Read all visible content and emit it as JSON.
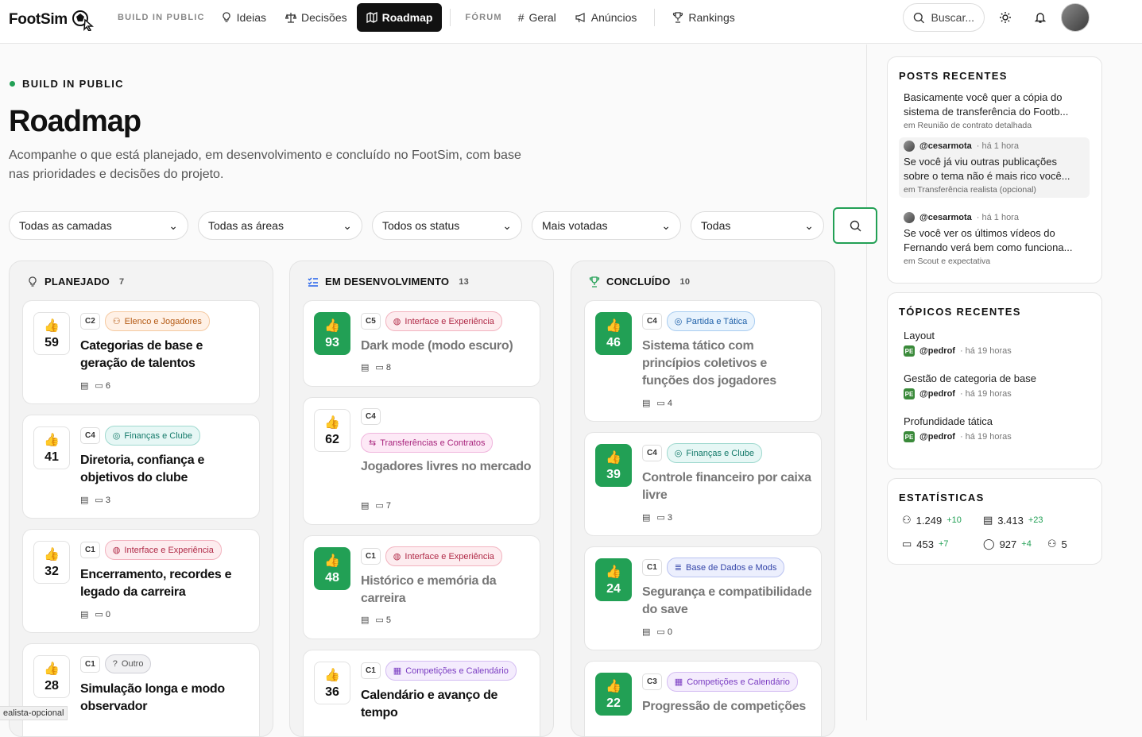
{
  "brand": "FootSim",
  "nav": {
    "section_build": "BUILD IN PUBLIC",
    "ideias": "Ideias",
    "decisoes": "Decisões",
    "roadmap": "Roadmap",
    "section_forum": "FÓRUM",
    "geral": "Geral",
    "anuncios": "Anúncios",
    "rankings": "Rankings",
    "search": "Buscar..."
  },
  "header": {
    "kicker": "BUILD IN PUBLIC",
    "title": "Roadmap",
    "subtitle": "Acompanhe o que está planejado, em desenvolvimento e concluído no FootSim, com base nas prioridades e decisões do projeto."
  },
  "filters": {
    "camadas": "Todas as camadas",
    "areas": "Todas as áreas",
    "status": "Todos os status",
    "ordem": "Mais votadas",
    "todas": "Todas"
  },
  "columns": [
    {
      "title": "PLANEJADO",
      "count": "7",
      "cards": [
        {
          "votes": "59",
          "layer": "C2",
          "area": "Elenco e Jogadores",
          "title": "Categorias de base e geração de talentos",
          "docs": "",
          "comments": "6"
        },
        {
          "votes": "41",
          "layer": "C4",
          "area": "Finanças e Clube",
          "title": "Diretoria, confiança e objetivos do clube",
          "docs": "",
          "comments": "3"
        },
        {
          "votes": "32",
          "layer": "C1",
          "area": "Interface e Experiência",
          "title": "Encerramento, recordes e legado da carreira",
          "docs": "",
          "comments": "0"
        },
        {
          "votes": "28",
          "layer": "C1",
          "area": "Outro",
          "title": "Simulação longa e modo observador",
          "docs": "",
          "comments": ""
        }
      ]
    },
    {
      "title": "EM DESENVOLVIMENTO",
      "count": "13",
      "cards": [
        {
          "votes": "93",
          "layer": "C5",
          "area": "Interface e Experiência",
          "title": "Dark mode (modo escuro)",
          "docs": "",
          "comments": "8"
        },
        {
          "votes": "62",
          "layer": "C4",
          "area": "Transferências e Contratos",
          "title": "Jogadores livres no mercado",
          "docs": "",
          "comments": "7"
        },
        {
          "votes": "48",
          "layer": "C1",
          "area": "Interface e Experiência",
          "title": "Histórico e memória da carreira",
          "docs": "",
          "comments": "5"
        },
        {
          "votes": "36",
          "layer": "C1",
          "area": "Competições e Calendário",
          "title": "Calendário e avanço de tempo",
          "docs": "",
          "comments": ""
        }
      ]
    },
    {
      "title": "CONCLUÍDO",
      "count": "10",
      "cards": [
        {
          "votes": "46",
          "layer": "C4",
          "area": "Partida e Tática",
          "title": "Sistema tático com princípios coletivos e funções dos jogadores",
          "docs": "",
          "comments": "4"
        },
        {
          "votes": "39",
          "layer": "C4",
          "area": "Finanças e Clube",
          "title": "Controle financeiro por caixa livre",
          "docs": "",
          "comments": "3"
        },
        {
          "votes": "24",
          "layer": "C1",
          "area": "Base de Dados e Mods",
          "title": "Segurança e compatibilidade do save",
          "docs": "",
          "comments": "0"
        },
        {
          "votes": "22",
          "layer": "C3",
          "area": "Competições e Calendário",
          "title": "Progressão de competições",
          "docs": "",
          "comments": ""
        }
      ]
    }
  ],
  "sidebar": {
    "posts_title": "POSTS RECENTES",
    "posts": [
      {
        "user": "",
        "ago": "",
        "text": "Basicamente você quer a cópia do sistema de transferência do Footb...",
        "sub": "em Reunião de contrato detalhada"
      },
      {
        "user": "@cesarmota",
        "ago": "· há 1 hora",
        "text": "Se você já viu outras publicações sobre o tema não é mais rico você...",
        "sub": "em Transferência realista (opcional)"
      },
      {
        "user": "@cesarmota",
        "ago": "· há 1 hora",
        "text": "Se você ver os últimos vídeos do Fernando verá bem como funciona...",
        "sub": "em Scout e expectativa"
      }
    ],
    "topics_title": "TÓPICOS RECENTES",
    "topics": [
      {
        "title": "Layout",
        "user": "@pedrof",
        "ago": "· há 19 horas"
      },
      {
        "title": "Gestão de categoria de base",
        "user": "@pedrof",
        "ago": "· há 19 horas"
      },
      {
        "title": "Profundidade tática",
        "user": "@pedrof",
        "ago": "· há 19 horas"
      }
    ],
    "stats_title": "ESTATÍSTICAS",
    "stats": {
      "users": "1.249",
      "users_plus": "+10",
      "docs": "3.413",
      "docs_plus": "+23",
      "threads": "453",
      "threads_plus": "+7",
      "comments": "927",
      "comments_plus": "+4",
      "online": "5"
    }
  },
  "status_url": "ealista-opcional",
  "colors": {
    "accent": "#22a055"
  }
}
